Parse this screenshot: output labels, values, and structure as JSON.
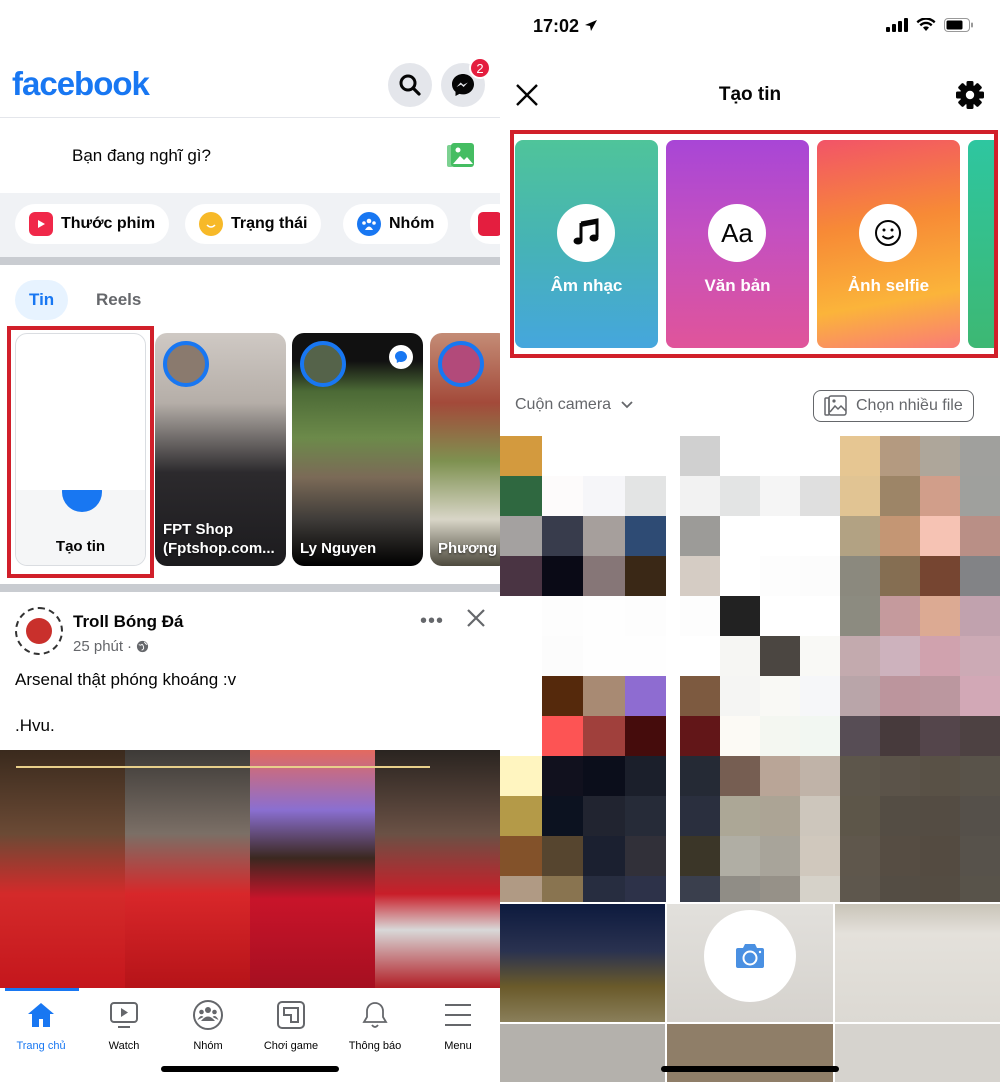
{
  "left": {
    "header": {
      "logo": "facebook",
      "search_icon": "search-icon",
      "messenger_icon": "messenger-icon",
      "messenger_badge": "2"
    },
    "composer": {
      "placeholder": "Bạn đang nghĩ gì?"
    },
    "chips": [
      {
        "label": "Thước phim",
        "icon": "reels-icon",
        "color": "#f02849"
      },
      {
        "label": "Trạng thái",
        "icon": "smiley-icon",
        "color": "#f7b928"
      },
      {
        "label": "Nhóm",
        "icon": "group-icon",
        "color": "#1877f2"
      },
      {
        "label": "",
        "icon": "live-icon",
        "color": "#e41e3f"
      }
    ],
    "stories": {
      "tabs": [
        {
          "label": "Tin",
          "active": true
        },
        {
          "label": "Reels",
          "active": false
        }
      ],
      "create_label": "Tạo tin",
      "items": [
        {
          "name": "FPT Shop (Fptshop.com..."
        },
        {
          "name": "Ly Nguyen"
        },
        {
          "name": "Phương T"
        }
      ]
    },
    "post": {
      "author": "Troll Bóng Đá",
      "time": "25 phút",
      "privacy_icon": "globe-icon",
      "text": "Arsenal thật phóng khoáng :v",
      "signature": ".Hvu."
    },
    "tabbar": [
      {
        "label": "Trang chủ",
        "icon": "home-icon",
        "active": true
      },
      {
        "label": "Watch",
        "icon": "watch-icon",
        "active": false
      },
      {
        "label": "Nhóm",
        "icon": "groups-icon",
        "active": false
      },
      {
        "label": "Chơi game",
        "icon": "gaming-icon",
        "active": false
      },
      {
        "label": "Thông báo",
        "icon": "bell-icon",
        "active": false
      },
      {
        "label": "Menu",
        "icon": "menu-icon",
        "active": false
      }
    ]
  },
  "right": {
    "status": {
      "time": "17:02"
    },
    "nav": {
      "title": "Tạo tin"
    },
    "story_types": [
      {
        "label": "Âm nhạc",
        "icon": "music-note-icon"
      },
      {
        "label": "Văn bản",
        "icon": "text-aa-icon",
        "glyph": "Aa"
      },
      {
        "label": "Ảnh selfie",
        "icon": "smiley-icon"
      }
    ],
    "gallery": {
      "album": "Cuộn camera",
      "multi_select": "Chọn nhiều file"
    }
  },
  "colors": {
    "brand": "#1877f2",
    "highlight": "#d11f2a",
    "badge": "#e41e3f"
  }
}
